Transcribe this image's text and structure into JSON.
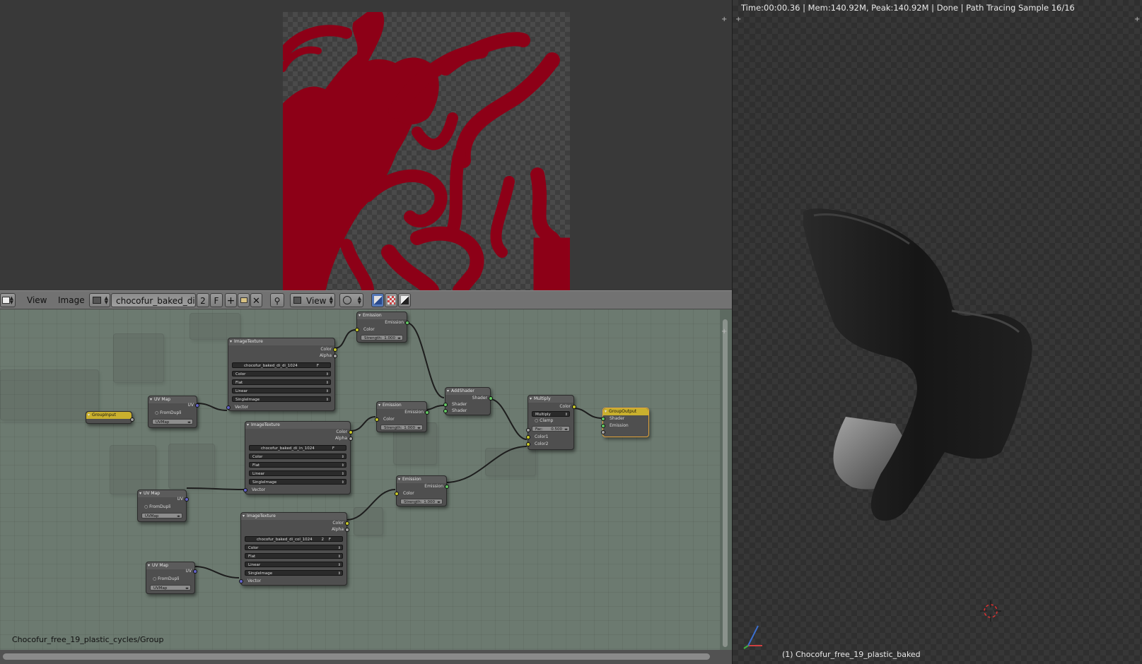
{
  "image_editor": {
    "header": {
      "menu_view": "View",
      "menu_image": "Image",
      "image_name": "chocofur_baked_di_...",
      "users_count": "2",
      "fake_user": "F",
      "display_mode": "View"
    }
  },
  "node_editor": {
    "group_path": "Chocofur_free_19_plastic_cycles/Group",
    "nodes": {
      "group_input": {
        "title": "GroupInput"
      },
      "group_output": {
        "title": "GroupOutput",
        "shader": "Shader",
        "emission": "Emission"
      },
      "image_texture_1": {
        "title": "ImageTexture",
        "color": "Color",
        "alpha": "Alpha",
        "image": "chocofur_baked_di_di_1024",
        "f": "F",
        "color_space": "Color",
        "projection": "Flat",
        "interpolation": "Linear",
        "source": "SingleImage",
        "vector": "Vector"
      },
      "image_texture_2": {
        "title": "ImageTexture",
        "color": "Color",
        "alpha": "Alpha",
        "image": "chocofur_baked_di_in_1024",
        "f": "F",
        "color_space": "Color",
        "projection": "Flat",
        "interpolation": "Linear",
        "source": "SingleImage",
        "vector": "Vector"
      },
      "image_texture_3": {
        "title": "ImageTexture",
        "color": "Color",
        "alpha": "Alpha",
        "image": "chocofur_baked_di_col_1024",
        "count": "2",
        "f": "F",
        "color_space": "Color",
        "projection": "Flat",
        "interpolation": "Linear",
        "source": "SingleImage",
        "vector": "Vector"
      },
      "uv_map_1": {
        "title": "UV Map",
        "uv": "UV",
        "from_dupli": "FromDupli",
        "uvmap": "UVMap"
      },
      "uv_map_2": {
        "title": "UV Map",
        "uv": "UV",
        "from_dupli": "FromDupli",
        "uvmap": "UVMap"
      },
      "uv_map_3": {
        "title": "UV Map",
        "uv": "UV",
        "from_dupli": "FromDupli",
        "uvmap": "UVMap"
      },
      "emission_1": {
        "title": "Emission",
        "emission": "Emission",
        "color": "Color",
        "strength_label": "Strength:",
        "strength": "1.000"
      },
      "emission_2": {
        "title": "Emission",
        "emission": "Emission",
        "color": "Color",
        "strength_label": "Strength:",
        "strength": "1.000"
      },
      "emission_3": {
        "title": "Emission",
        "emission": "Emission",
        "color": "Color",
        "strength_label": "Strength:",
        "strength": "1.000"
      },
      "add_shader": {
        "title": "AddShader",
        "shader_out": "Shader",
        "shader_in1": "Shader",
        "shader_in2": "Shader"
      },
      "multiply": {
        "title": "Multiply",
        "color": "Color",
        "mode": "Multiply",
        "clamp": "Clamp",
        "fac_label": "Fac:",
        "fac": "0.500",
        "color1": "Color1",
        "color2": "Color2"
      }
    }
  },
  "viewport": {
    "render_info": "Time:00:00.36 | Mem:140.92M, Peak:140.92M | Done | Path Tracing Sample 16/16",
    "object_label": "(1) Chocofur_free_19_plastic_baked"
  },
  "colors": {
    "baked_texture": "#8d0017",
    "node_bg": "#6c7a70",
    "header": "#727272",
    "active_node_border": "#e3a33a"
  }
}
